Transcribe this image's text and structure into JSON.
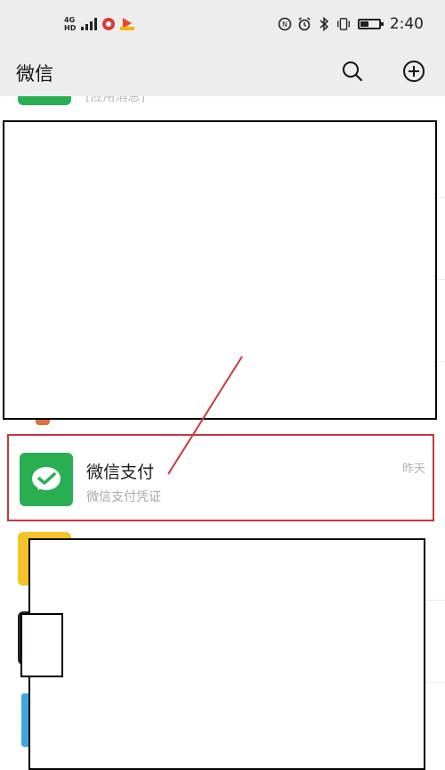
{
  "status_bar": {
    "network_type": "4G",
    "network_subtype": "HD",
    "icons": [
      "signal-icon",
      "app-notification-icon",
      "video-app-icon",
      "nfc-icon",
      "alarm-icon",
      "bluetooth-icon",
      "vibrate-icon",
      "battery-icon"
    ],
    "time": "2:40"
  },
  "header": {
    "title": "微信",
    "search_icon": "search-icon",
    "add_icon": "plus-circle-icon"
  },
  "chats": [
    {
      "name": "微信支付",
      "preview": "微信支付凭证",
      "time": "昨天",
      "avatar_color": "#2aae52",
      "highlighted": true
    }
  ],
  "partial_top_message": "[应用消息]",
  "colors": {
    "header_bg": "#ededed",
    "wechat_green": "#2aae52",
    "highlight_border": "#c8383d",
    "annotation_line": "#c8383d"
  }
}
